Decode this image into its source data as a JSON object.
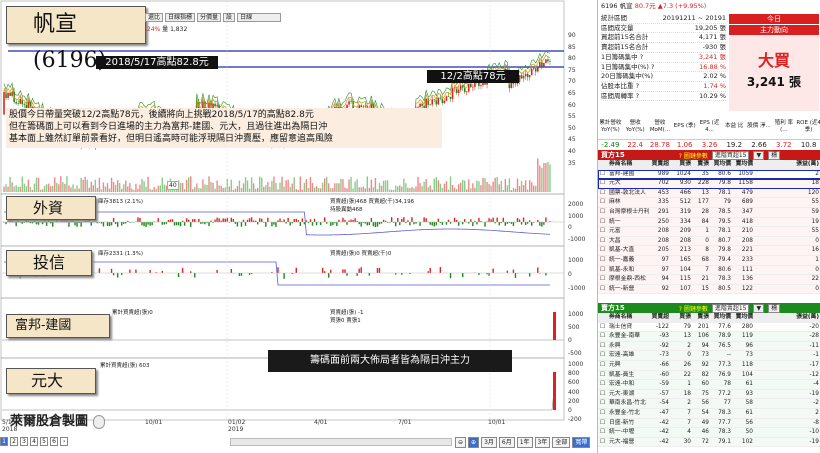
{
  "stock": {
    "title": "帆宣(6196)"
  },
  "toolbar": {
    "items": [
      "還比",
      "日線指標",
      "分價量",
      "設",
      "日線"
    ]
  },
  "legend_top": {
    "change": ".24%",
    "volume_label": "量 1,832"
  },
  "labels": {
    "high_2018": "2018/5/17高點82.8元",
    "high_1212": "12/2高點78元",
    "annotation_lines": [
      "股價今日帶量突破12/2高點78元，後續將向上挑戰2018/5/17的高點82.8元",
      "但在籌碼面上可以看到今日進場的主力為富邦-建國、元大，且過往進出為隔日沖",
      "基本面上雖然訂單前景看好，但明日遙高時可能浮現隔日沖賣壓，應留意追高風險"
    ],
    "panel_foreign": "外資",
    "panel_trust": "投信",
    "panel_broker1": "富邦-建國",
    "panel_broker2": "元大",
    "callout": "籌碼面前兩大佈局者皆為隔日沖主力",
    "watermark": "萊爾股倉製圖"
  },
  "price_axis": [
    "90",
    "85",
    "80",
    "75",
    "70",
    "65",
    "60",
    "55",
    "50",
    "45",
    "40",
    "35"
  ],
  "price_marker": "40",
  "foreign_legend": {
    "left": "庫存3813 (2.1%)",
    "right1": "買賣超(張)468 買賣超(千)34,196",
    "right2": "持股異動468"
  },
  "foreign_axis": [
    "2000",
    "1000",
    "0",
    "-1000"
  ],
  "trust_legend": {
    "left": "庫存2331 (1.3%)",
    "right1": "買賣超(張)0 買賣超(千)0"
  },
  "trust_axis": [
    "1000",
    "0",
    "-1000"
  ],
  "broker1_legend": {
    "left": "累計買賣超(張)0",
    "right1": "買賣超(張) -1",
    "right2": "買張0 賣張1"
  },
  "broker1_axis": [
    "1000",
    "500",
    "0",
    "-500"
  ],
  "broker2_legend": {
    "left": "累計買賣超(張) 603"
  },
  "broker2_axis": [
    "1000",
    "800",
    "600",
    "400",
    "200",
    "0",
    "-200"
  ],
  "x_axis": [
    {
      "top": "5/15",
      "bottom": "2018"
    },
    {
      "top": "10/01",
      "bottom": ""
    },
    {
      "top": "01/02",
      "bottom": "2019"
    },
    {
      "top": "4/01",
      "bottom": ""
    },
    {
      "top": "7/01",
      "bottom": ""
    },
    {
      "top": "10/01",
      "bottom": ""
    }
  ],
  "pages": [
    "1",
    "2",
    "3",
    "4",
    "5",
    "6"
  ],
  "range_buttons": [
    "3月",
    "6月",
    "1年",
    "3年",
    "全部",
    "寬帶"
  ],
  "quote": {
    "name": "6196 帆宣",
    "price": "80.7元",
    "change": "▲7.3 (+9.95%)"
  },
  "stats": [
    {
      "label": "統計區間",
      "value": "20191211 ~ 20191",
      "red": false
    },
    {
      "label": "區間成交量",
      "value": "19,205 張",
      "red": false
    },
    {
      "label": "買超前15名合計",
      "value": "4,171 張",
      "red": false
    },
    {
      "label": "賣超前15名合計",
      "value": "-930 張",
      "red": false
    },
    {
      "label": "1日籌碼集中 ?",
      "value": "3,241 張",
      "red": true
    },
    {
      "label": "1日籌碼集中(%) ?",
      "value": "16.88 %",
      "red": true
    },
    {
      "label": "20日籌碼集中(%)",
      "value": "2.02 %",
      "red": false
    },
    {
      "label": "佔股本比重 ?",
      "value": "1.74 %",
      "red": true
    },
    {
      "label": "區間周轉率 ?",
      "value": "10.29 %",
      "red": false
    }
  ],
  "direction": {
    "h1": "今日",
    "h2": "主力動向",
    "big": "大買",
    "qty": "3,241 張"
  },
  "fund_headers": [
    "累計營收 YoY(%)",
    "營收 YoY(%)",
    "營收 MoM(...",
    "EPS (季)",
    "EPS (近4...",
    "本益 比",
    "股價 淨...",
    "殖利 率(...",
    "ROE (近4季)"
  ],
  "fund_values": [
    {
      "v": "-2.49",
      "c": "g"
    },
    {
      "v": "22.4",
      "c": "r"
    },
    {
      "v": "28.78",
      "c": "r"
    },
    {
      "v": "1.06",
      "c": "r"
    },
    {
      "v": "3.26",
      "c": "r"
    },
    {
      "v": "19.2",
      "c": ""
    },
    {
      "v": "2.66",
      "c": ""
    },
    {
      "v": "3.72",
      "c": "r"
    },
    {
      "v": "10.8",
      "c": ""
    }
  ],
  "buy": {
    "title": "買方15",
    "ref": "? 圖鏈參數",
    "select": "進階買超15",
    "btn1": "▼",
    "btn2": "標",
    "head": [
      "",
      "券商名稱",
      "買賣超",
      "買張",
      "賣張",
      "買均價",
      "賣均價",
      "張益(萬)"
    ],
    "rows": [
      [
        "",
        "富邦-建國",
        "989",
        "1024",
        "35",
        "80.6",
        "1059",
        "2"
      ],
      [
        "",
        "元大",
        "702",
        "930",
        "228",
        "79.8",
        "1158",
        "18"
      ],
      [
        "",
        "國票-敦北法人",
        "453",
        "466",
        "13",
        "78.1",
        "479",
        "120"
      ],
      [
        "",
        "麻林",
        "335",
        "512",
        "177",
        "79",
        "689",
        "55"
      ],
      [
        "",
        "台灣摩根士丹利",
        "291",
        "319",
        "28",
        "78.5",
        "347",
        "59"
      ],
      [
        "",
        "統一",
        "250",
        "334",
        "84",
        "79.5",
        "418",
        "19"
      ],
      [
        "",
        "元富",
        "208",
        "209",
        "1",
        "78.1",
        "210",
        "55"
      ],
      [
        "",
        "大昌",
        "208",
        "208",
        "0",
        "80.7",
        "208",
        "0"
      ],
      [
        "",
        "凱基-大直",
        "205",
        "213",
        "8",
        "79.8",
        "221",
        "16"
      ],
      [
        "",
        "統一-嘉義",
        "97",
        "165",
        "68",
        "79.4",
        "233",
        "1"
      ],
      [
        "",
        "凱基-永和",
        "97",
        "104",
        "7",
        "80.6",
        "111",
        "0"
      ],
      [
        "",
        "摩根金鼎-西松",
        "94",
        "115",
        "21",
        "78.3",
        "136",
        "22"
      ],
      [
        "",
        "統一-新營",
        "92",
        "107",
        "15",
        "80.5",
        "122",
        "0"
      ]
    ]
  },
  "sell": {
    "title": "賣方15",
    "ref": "? 圖鏈參數",
    "select": "進階賣超15",
    "btn1": "▼",
    "btn2": "標",
    "head": [
      "",
      "券商名稱",
      "買賣超",
      "買張",
      "賣張",
      "買均價",
      "賣均價",
      "張益(萬)"
    ],
    "rows": [
      [
        "",
        "瑞士信貸",
        "-122",
        "79",
        "201",
        "77.6",
        "280",
        "-20"
      ],
      [
        "",
        "永豐金-南華",
        "-93",
        "13",
        "106",
        "78.9",
        "119",
        "-28"
      ],
      [
        "",
        "永興",
        "-92",
        "2",
        "94",
        "76.5",
        "96",
        "-11"
      ],
      [
        "",
        "宏遠-高雄",
        "-73",
        "0",
        "73",
        "--",
        "73",
        "-1"
      ],
      [
        "",
        "元興",
        "-66",
        "26",
        "92",
        "77.3",
        "118",
        "-17"
      ],
      [
        "",
        "凱基-員生",
        "-60",
        "22",
        "82",
        "76.9",
        "104",
        "-12"
      ],
      [
        "",
        "宏遠-中和",
        "-59",
        "1",
        "60",
        "78",
        "61",
        "-4"
      ],
      [
        "",
        "元大-東湖",
        "-57",
        "18",
        "75",
        "77.2",
        "93",
        "-19"
      ],
      [
        "",
        "華南永昌-竹北",
        "-54",
        "2",
        "56",
        "77",
        "58",
        "-2"
      ],
      [
        "",
        "永豐金-竹北",
        "-47",
        "7",
        "54",
        "78.3",
        "61",
        "2"
      ],
      [
        "",
        "日盛-新竹",
        "-42",
        "7",
        "49",
        "77.7",
        "56",
        "-8"
      ],
      [
        "",
        "統一-中壢",
        "-42",
        "4",
        "46",
        "78.3",
        "50",
        "-10"
      ],
      [
        "",
        "元大-福營",
        "-42",
        "30",
        "72",
        "79.1",
        "102",
        "-19"
      ]
    ]
  }
}
